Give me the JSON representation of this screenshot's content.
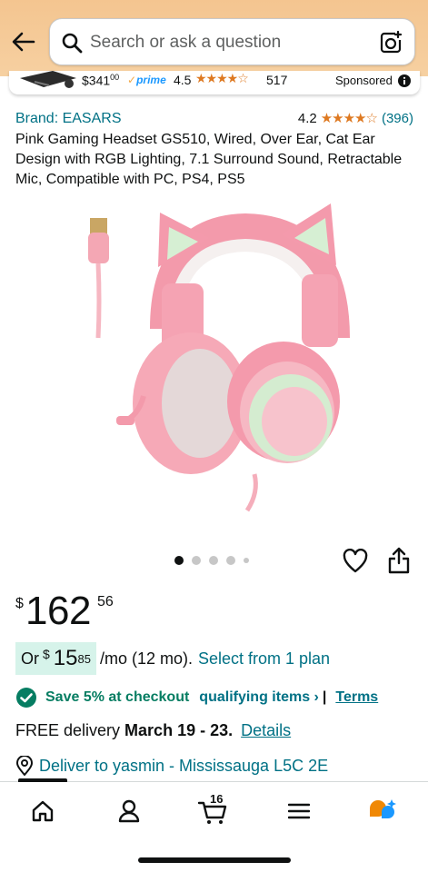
{
  "search": {
    "placeholder": "Search or ask a question"
  },
  "sponsored_strip": {
    "price_whole": "$341",
    "price_cents": "00",
    "prime": "prime",
    "rating": "4.5",
    "stars": "★★★★☆",
    "review_count": "517",
    "label": "Sponsored"
  },
  "product": {
    "brand": "Brand: EASARS",
    "rating": "4.2",
    "stars": "★★★★☆",
    "review_count": "(396)",
    "title": "Pink Gaming Headset GS510, Wired, Over Ear, Cat Ear Design with RGB Lighting, 7.1 Surround Sound, Retractable Mic, Compatible with PC, PS4, PS5"
  },
  "carousel": {
    "image_count": 5,
    "active_index": 0
  },
  "price": {
    "currency": "$",
    "whole": "162",
    "cents": "56"
  },
  "monthly": {
    "prefix": "Or",
    "currency": "$",
    "whole": "15",
    "cents": "85",
    "term": "/mo (12 mo).",
    "plan_link": "Select from 1 plan"
  },
  "checkout": {
    "save_text": "Save 5% at checkout",
    "qualifying_link": "qualifying items ›",
    "separator": "|",
    "terms_link": "Terms"
  },
  "delivery": {
    "prefix": "FREE delivery",
    "dates": "March 19 - 23.",
    "details_link": "Details"
  },
  "deliver_to": "Deliver to yasmin - Mississauga L5C 2E",
  "nav": {
    "cart_count": "16",
    "items": [
      "home-icon",
      "account-icon",
      "cart-icon",
      "menu-icon",
      "rufus-icon"
    ]
  },
  "colors": {
    "header_bg": "#f4c590",
    "link": "#007185",
    "success": "#067d62",
    "star": "#de7921",
    "prime": "#1a98ff",
    "monthly_badge": "#d6f3ea"
  }
}
